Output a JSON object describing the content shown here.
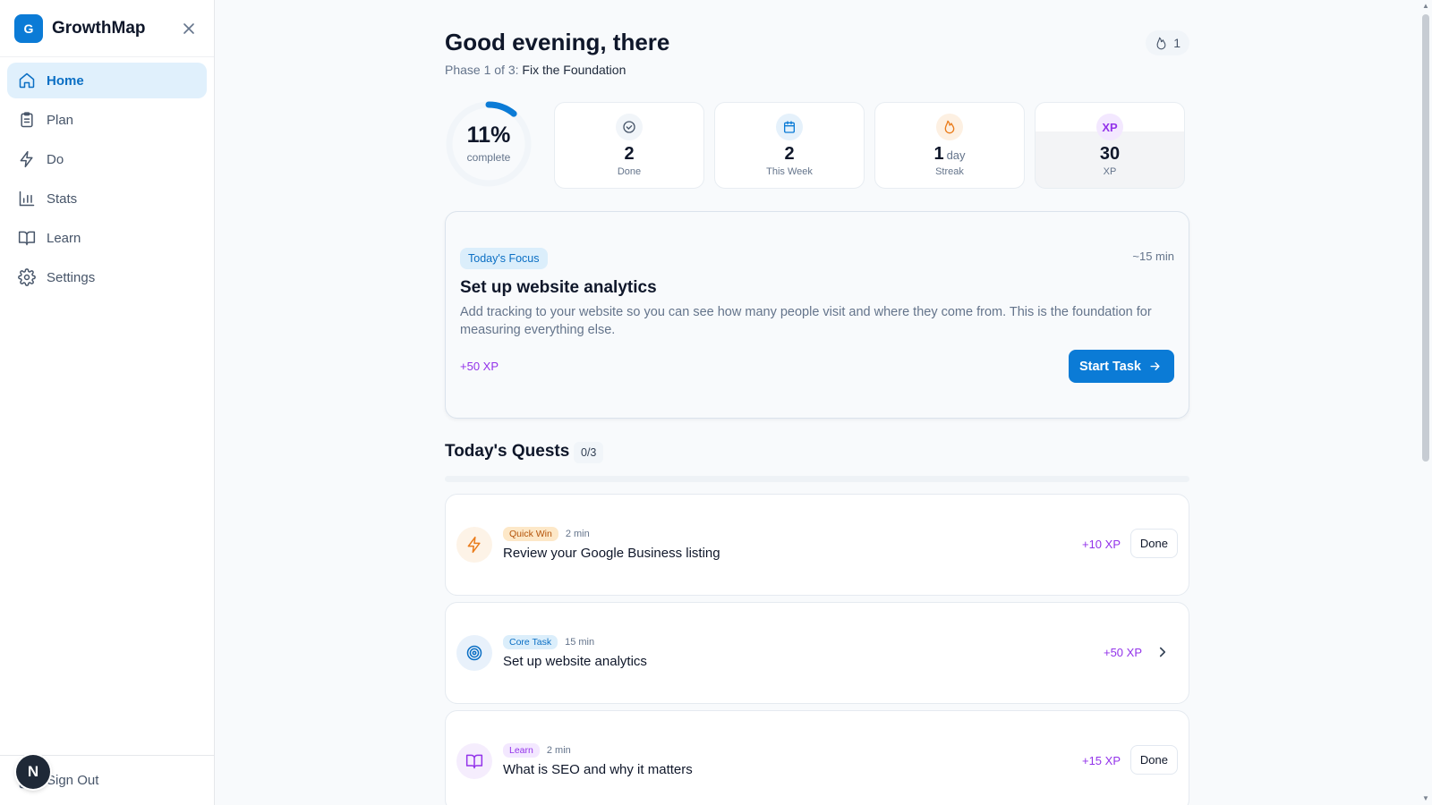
{
  "brand": {
    "logo_letter": "G",
    "name": "GrowthMap",
    "close_icon": "close-icon"
  },
  "nav": [
    {
      "label": "Home",
      "icon": "home-icon",
      "active": true
    },
    {
      "label": "Plan",
      "icon": "clipboard-icon"
    },
    {
      "label": "Do",
      "icon": "lightning-icon"
    },
    {
      "label": "Stats",
      "icon": "bar-chart-icon"
    },
    {
      "label": "Learn",
      "icon": "book-icon"
    },
    {
      "label": "Settings",
      "icon": "gear-icon"
    }
  ],
  "footer": {
    "signout_label": "Sign Out",
    "avatar_letter": "N"
  },
  "header": {
    "greeting": "Good evening, there",
    "phase_prefix": "Phase 1 of 3:",
    "phase_name": "Fix the Foundation",
    "streak_count": "1"
  },
  "progress": {
    "value": "11%",
    "label": "complete",
    "fraction": 0.11
  },
  "stats": [
    {
      "value": "2",
      "unit": "",
      "label": "Done",
      "icon": "check-circle-icon",
      "color": "#475569"
    },
    {
      "value": "2",
      "unit": "",
      "label": "This Week",
      "icon": "calendar-icon",
      "color": "#0b7bd6"
    },
    {
      "value": "1",
      "unit": "day",
      "label": "Streak",
      "icon": "flame-icon",
      "color": "#ea7c1b"
    },
    {
      "value": "30",
      "unit": "",
      "label": "XP",
      "icon_text": "XP",
      "color": "#9333ea"
    }
  ],
  "focus": {
    "badge": "Today's Focus",
    "time": "~15 min",
    "title": "Set up website analytics",
    "description": "Add tracking to your website so you can see how many people visit and where they come from. This is the foundation for measuring everything else.",
    "xp": "+50 XP",
    "button": "Start Task"
  },
  "quests": {
    "title": "Today's Quests",
    "count": "0/3",
    "items": [
      {
        "badge": "Quick Win",
        "time": "2 min",
        "title": "Review your Google Business listing",
        "xp": "+10 XP",
        "action": "Done",
        "icon": "lightning-icon"
      },
      {
        "badge": "Core Task",
        "time": "15 min",
        "title": "Set up website analytics",
        "xp": "+50 XP",
        "action": "",
        "icon": "target-icon"
      },
      {
        "badge": "Learn",
        "time": "2 min",
        "title": "What is SEO and why it matters",
        "xp": "+15 XP",
        "action": "Done",
        "icon": "book-icon"
      }
    ]
  },
  "colors": {
    "accent": "#0b7bd6",
    "xp": "#9333ea",
    "quick_win": "#ea7c1b"
  }
}
